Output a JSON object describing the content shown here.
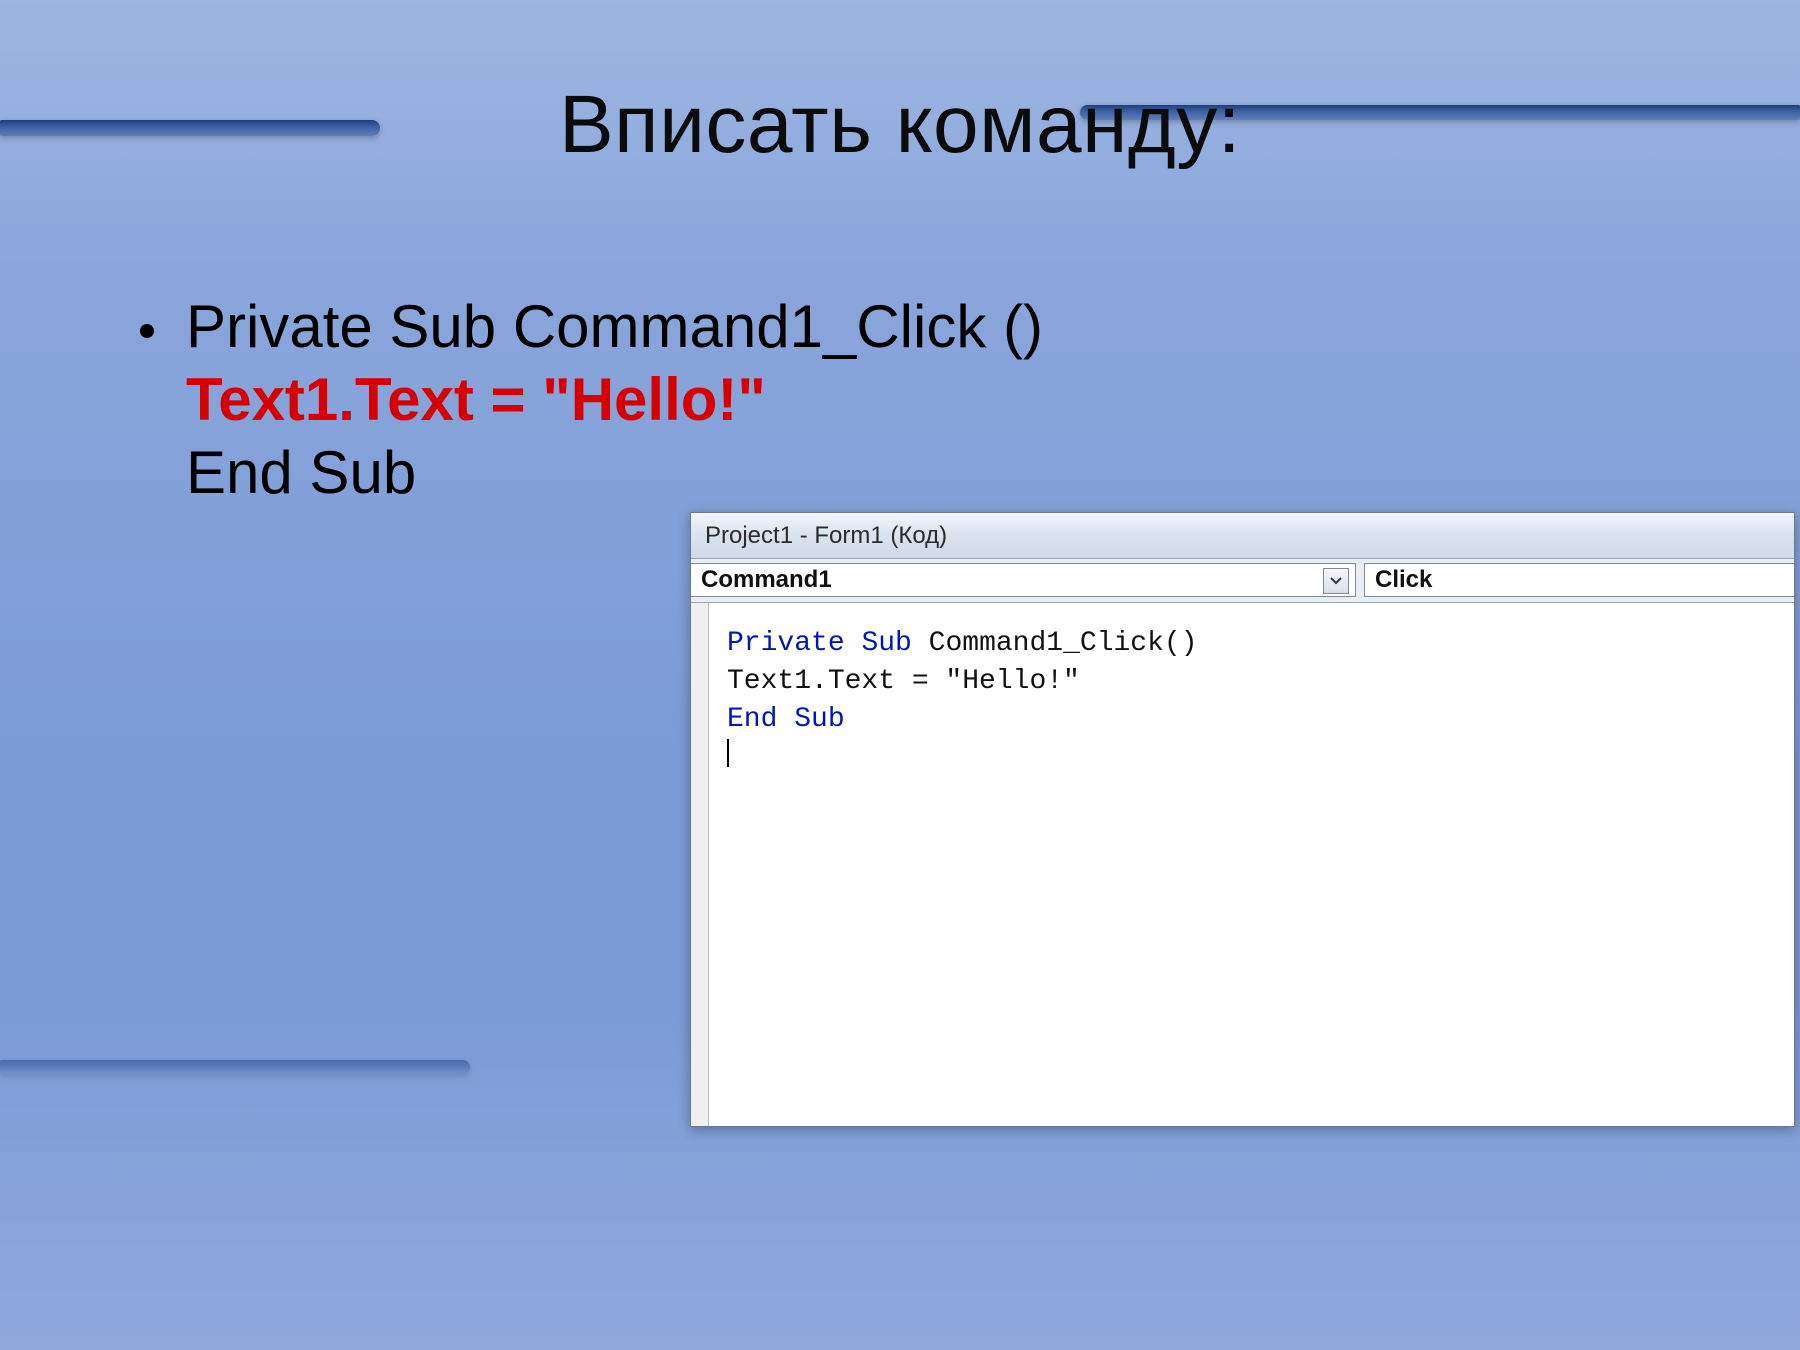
{
  "slide": {
    "title": "Вписать команду:",
    "bullet": {
      "line1": "Private Sub Command1_Click ()",
      "line2_red": "Text1.Text = \"Hello!\"",
      "line3": "End Sub"
    }
  },
  "code_window": {
    "title": "Project1 - Form1 (Код)",
    "object_dropdown": "Command1",
    "event_dropdown": "Click",
    "code": {
      "l1_kw1": "Private",
      "l1_kw2": "Sub",
      "l1_rest": " Command1_Click()",
      "l2": "Text1.Text = \"Hello!\"",
      "l3_kw1": "End",
      "l3_kw2": "Sub"
    }
  }
}
